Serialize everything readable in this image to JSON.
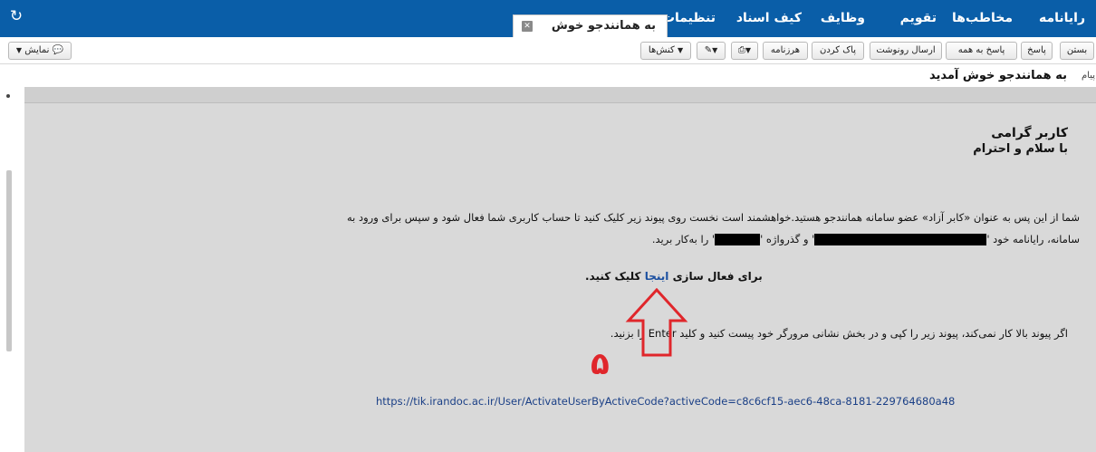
{
  "header": {
    "nav": [
      "رایانامه",
      "مخاطب‌ها",
      "تقویم",
      "وظایف",
      "کیف اسناد",
      "تنظیمات"
    ],
    "active_tab": "به همانندجو خوش",
    "close_glyph": "✕",
    "refresh_glyph": "↻"
  },
  "toolbar": {
    "close": "بستن",
    "reply": "پاسخ",
    "reply_all": "پاسخ به همه",
    "send_copy": "ارسال رونوشت",
    "delete": "پاک کردن",
    "junk": "هرزنامه",
    "actions": "کنش‌ها",
    "view": "نمایش"
  },
  "message": {
    "subject_prefix": "پیام",
    "subject": "به همانندجو خوش آمدید",
    "greeting_line1": "کاربر گرامی",
    "greeting_line2": "با سلام و احترام",
    "paragraph1_line1": "شما از این پس به عنوان «کابر آزاد» عضو سامانه همانندجو هستید.خواهشمند است نخست روی پیوند زیر کلیک کنید تا حساب کاربری شما فعال شود و سپس برای ورود به",
    "paragraph1_line2_a": "سامانه، رایانامه خود '",
    "paragraph1_line2_b": "' و گذرواژه '",
    "paragraph1_line2_c": "' را به‌کار برید.",
    "activate_before": "برای فعال سازی",
    "activate_link": "اینجا",
    "activate_after": "کلیک کنید.",
    "paragraph2": "اگر پیوند بالا کار نمی‌کند، پیوند زیر را کپی و در بخش نشانی مرورگر خود پیست کنید و کلید Enter را بزنید.",
    "activation_url": "https://tik.irandoc.ac.ir/User/ActivateUserByActiveCode?activeCode=c8c6cf15-aec6-48ca-8181-229764680a48"
  },
  "annotation": {
    "step_number": "۵",
    "color": "#e0262b"
  }
}
